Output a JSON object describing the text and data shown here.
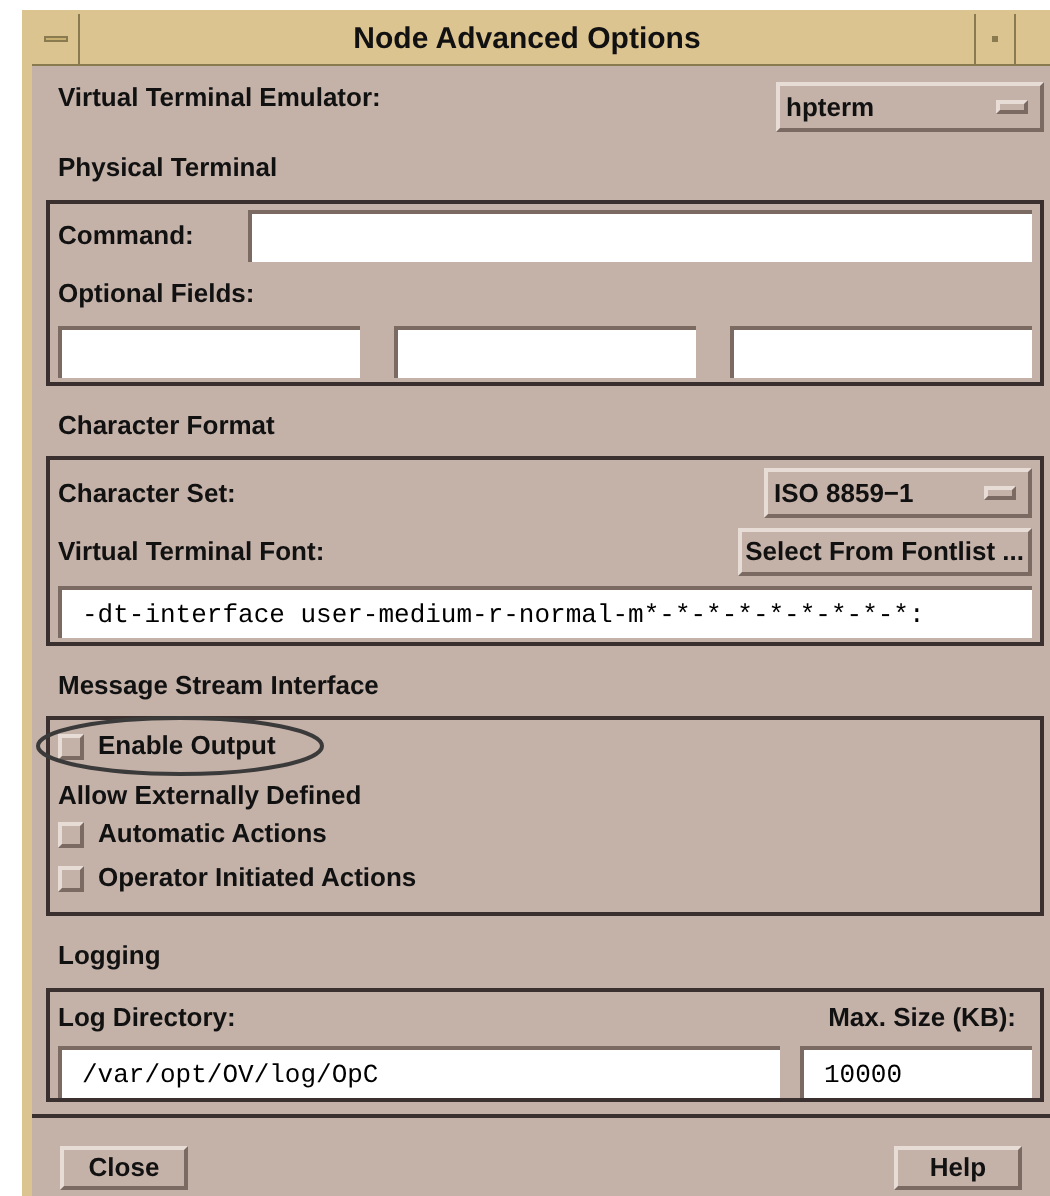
{
  "window": {
    "title": "Node Advanced Options"
  },
  "terminal_emulator": {
    "label": "Virtual Terminal Emulator:",
    "value": "hpterm"
  },
  "physical_terminal": {
    "title": "Physical Terminal",
    "command_label": "Command:",
    "optional_label": "Optional Fields:"
  },
  "character_format": {
    "title": "Character Format",
    "charset_label": "Character Set:",
    "charset_value": "ISO 8859−1",
    "font_label": "Virtual Terminal Font:",
    "font_button": "Select From Fontlist ...",
    "font_value": "-dt-interface user-medium-r-normal-m*-*-*-*-*-*-*-*-*:"
  },
  "message_stream": {
    "title": "Message Stream Interface",
    "enable": {
      "label": "Enable Output",
      "checked": false
    },
    "allow_label": "Allow Externally Defined",
    "options": [
      {
        "label": "Automatic Actions",
        "checked": false
      },
      {
        "label": "Operator Initiated Actions",
        "checked": false
      }
    ]
  },
  "logging": {
    "title": "Logging",
    "dir_label": "Log Directory:",
    "dir_value": "/var/opt/OV/log/OpC",
    "size_label": "Max. Size (KB):",
    "size_value": "10000"
  },
  "buttons": [
    "Close",
    "Help"
  ]
}
